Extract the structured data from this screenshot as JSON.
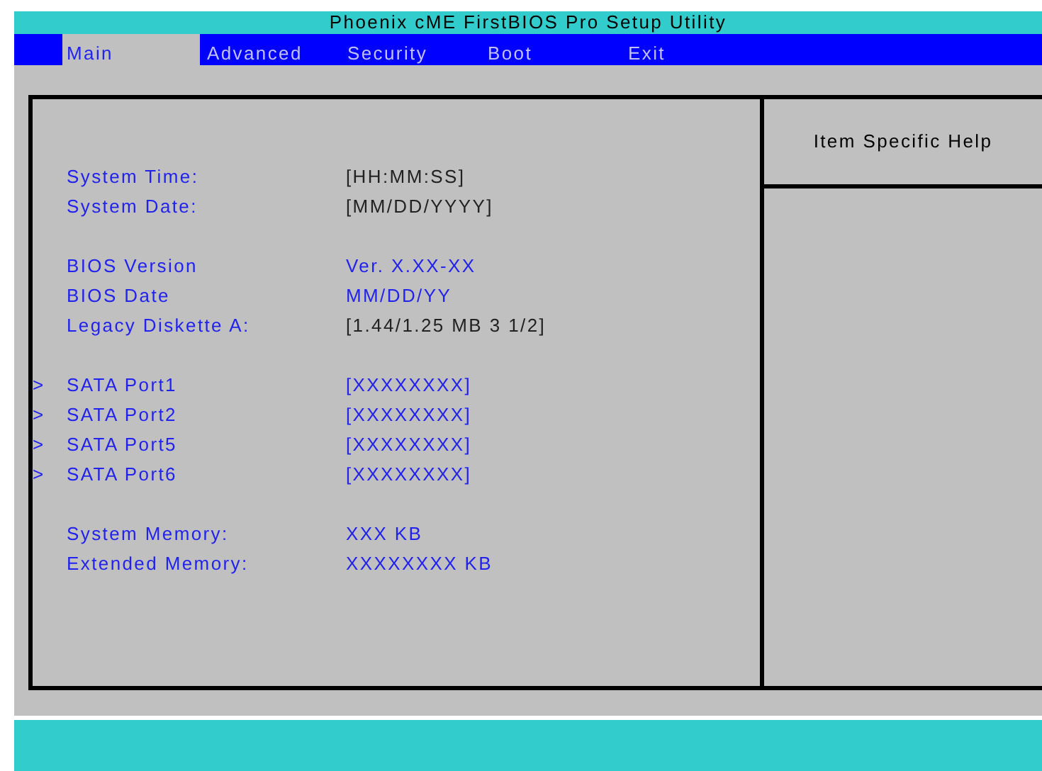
{
  "window": {
    "title": "Phoenix cME FirstBIOS Pro Setup Utility"
  },
  "tabs": [
    {
      "label": "Main",
      "selected": true
    },
    {
      "label": "Advanced",
      "selected": false
    },
    {
      "label": "Security",
      "selected": false
    },
    {
      "label": "Boot",
      "selected": false
    },
    {
      "label": "Exit",
      "selected": false
    }
  ],
  "groups": [
    {
      "items": [
        {
          "kind": "setting",
          "label": "System Time:",
          "value": "[HH:MM:SS]"
        },
        {
          "kind": "setting",
          "label": "System Date:",
          "value": "[MM/DD/YYYY]"
        }
      ]
    },
    {
      "items": [
        {
          "kind": "info",
          "label": "BIOS Version",
          "value": "Ver. X.XX-XX"
        },
        {
          "kind": "info",
          "label": "BIOS Date",
          "value": "MM/DD/YY"
        },
        {
          "kind": "setting",
          "label": "Legacy Diskette A:",
          "value": "[1.44/1.25 MB 3 1/2]"
        }
      ]
    },
    {
      "items": [
        {
          "kind": "submenu",
          "marker": ">",
          "label": "SATA Port1",
          "value": "[XXXXXXXX]"
        },
        {
          "kind": "submenu",
          "marker": ">",
          "label": "SATA Port2",
          "value": "[XXXXXXXX]"
        },
        {
          "kind": "submenu",
          "marker": ">",
          "label": "SATA Port5",
          "value": "[XXXXXXXX]"
        },
        {
          "kind": "submenu",
          "marker": ">",
          "label": "SATA Port6",
          "value": "[XXXXXXXX]"
        }
      ]
    },
    {
      "items": [
        {
          "kind": "info",
          "label": "System Memory:",
          "value": "XXX KB"
        },
        {
          "kind": "info",
          "label": "Extended Memory:",
          "value": "XXXXXXXX KB"
        }
      ]
    }
  ],
  "help": {
    "title": "Item Specific Help"
  }
}
